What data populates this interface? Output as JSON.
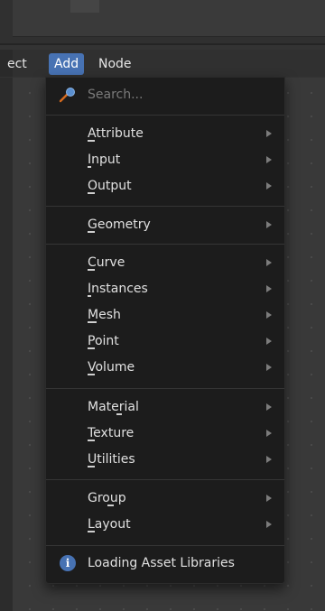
{
  "header_menu": {
    "items": [
      {
        "label": "ect",
        "active": false
      },
      {
        "label": "Add",
        "active": true
      },
      {
        "label": "Node",
        "active": false
      }
    ]
  },
  "add_menu": {
    "search": {
      "placeholder": "Search...",
      "icon": "search-icon"
    },
    "groups": [
      {
        "items": [
          {
            "label": "Attribute",
            "has_submenu": true
          },
          {
            "label": "Input",
            "has_submenu": true
          },
          {
            "label": "Output",
            "has_submenu": true
          }
        ]
      },
      {
        "items": [
          {
            "label": "Geometry",
            "has_submenu": true
          }
        ]
      },
      {
        "items": [
          {
            "label": "Curve",
            "has_submenu": true
          },
          {
            "label": "Instances",
            "has_submenu": true
          },
          {
            "label": "Mesh",
            "has_submenu": true
          },
          {
            "label": "Point",
            "has_submenu": true
          },
          {
            "label": "Volume",
            "has_submenu": true
          }
        ]
      },
      {
        "items": [
          {
            "label": "Material",
            "has_submenu": true
          },
          {
            "label": "Texture",
            "has_submenu": true
          },
          {
            "label": "Utilities",
            "has_submenu": true
          }
        ]
      },
      {
        "items": [
          {
            "label": "Group",
            "has_submenu": true
          },
          {
            "label": "Layout",
            "has_submenu": true
          }
        ]
      }
    ],
    "status": {
      "icon": "info-icon",
      "label": "Loading Asset Libraries"
    }
  },
  "colors": {
    "accent": "#4772b3",
    "menu_background": "#1c1c1c",
    "text": "#e0e0e0",
    "muted_text": "#7a7a7a"
  }
}
